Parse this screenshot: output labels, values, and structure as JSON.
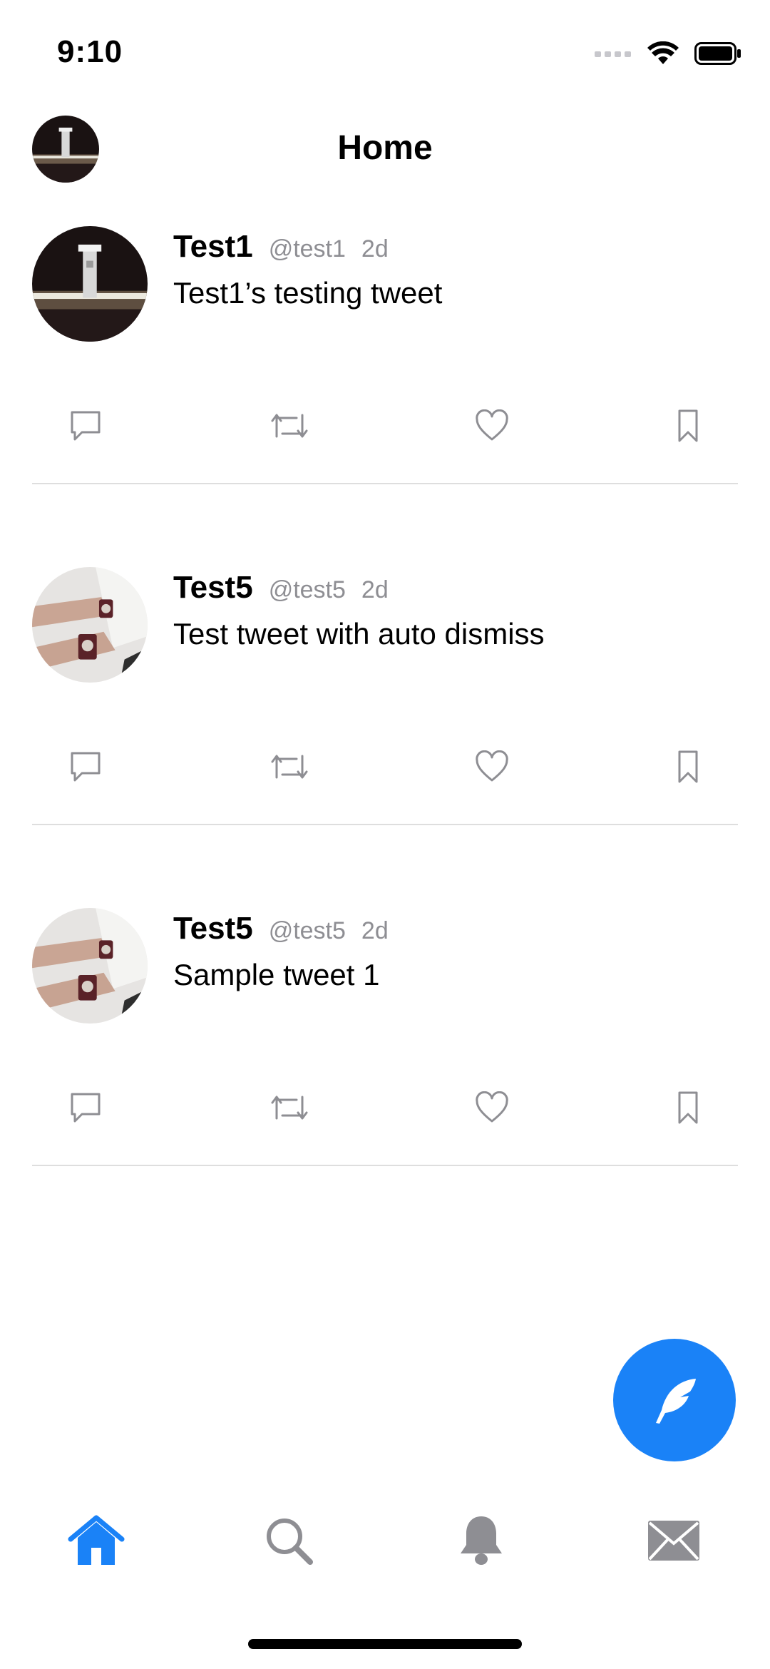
{
  "status_bar": {
    "time": "9:10"
  },
  "nav": {
    "title": "Home"
  },
  "tweets": [
    {
      "name": "Test1",
      "handle": "@test1",
      "time": "2d",
      "text": "Test1’s testing tweet",
      "avatar": "night-tower-photo"
    },
    {
      "name": "Test5",
      "handle": "@test5",
      "time": "2d",
      "text": "Test tweet with auto dismiss",
      "avatar": "wristband-photo"
    },
    {
      "name": "Test5",
      "handle": "@test5",
      "time": "2d",
      "text": "Sample tweet 1",
      "avatar": "wristband-photo"
    }
  ],
  "icons": {
    "actions": [
      "comment-icon",
      "retweet-icon",
      "like-icon",
      "bookmark-icon"
    ],
    "fab": "feather-icon",
    "tabs": [
      "home-icon",
      "search-icon",
      "notifications-icon",
      "messages-icon"
    ]
  },
  "colors": {
    "accent": "#1a82f7",
    "secondary_text": "#8e8e93",
    "icon_gray": "#8e8e93",
    "divider": "#dedede"
  }
}
